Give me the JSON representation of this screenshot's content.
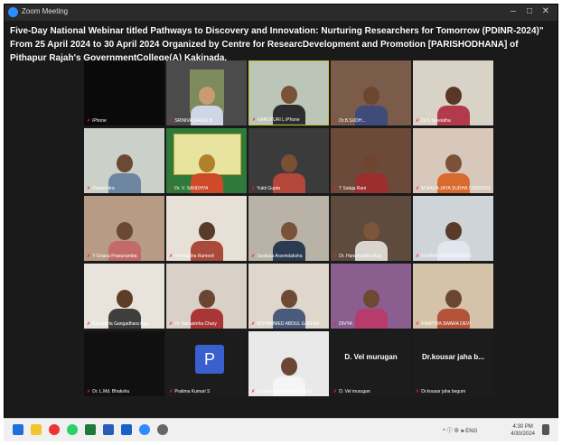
{
  "window": {
    "title": "Zoom Meeting",
    "minimize": "–",
    "maximize": "□",
    "close": "✕"
  },
  "banner": "Five-Day National Webinar titled Pathways to Discovery and Innovation: Nurturing Researchers for Tomorrow (PDINR-2024)\" From 25 April 2024 to 30 April 2024 Organized by Centre for ResearcDevelopment and Promotion [PARISHODHANA] of Pithapur Rajah's GovernmentCollege(A) Kakinada.",
  "participants": [
    {
      "name": "iPhone"
    },
    {
      "name": "SRINIVASARAO B"
    },
    {
      "name": "KARUTURI L iPhone"
    },
    {
      "name": "Dr.B.SUDH..."
    },
    {
      "name": "Dr.K.Sreelatha"
    },
    {
      "name": "Raveendra"
    },
    {
      "name": "Dr. V. SANDHYA"
    },
    {
      "name": "Yukti Gupta"
    },
    {
      "name": "T Salaja Rani"
    },
    {
      "name": "M NAGA JAYA SUDHA 12082002004"
    },
    {
      "name": "Y Gnana Prasunamba"
    },
    {
      "name": "Hemalatha Ramesh"
    },
    {
      "name": "Sasikala Aravindaksha"
    },
    {
      "name": "Dr. Hanumantha Rao"
    },
    {
      "name": "NUNNA SRINIVASARAO"
    },
    {
      "name": "Kancharla Gangadhara Rao"
    },
    {
      "name": "Dr. Narasimha Chary"
    },
    {
      "name": "MOHAMMED ABDUL GAFFAR"
    },
    {
      "name": "DIVYA"
    },
    {
      "name": "RAMITHA SWARA DEVI"
    },
    {
      "name": "Dr. L.Md. Bhakshu"
    },
    {
      "name": "Pratima Kumari S"
    },
    {
      "name": "Dr.Sivaramakrishna Prasad"
    },
    {
      "name": "D. Vel murugan",
      "display": "D. Vel murugan"
    },
    {
      "name": "Dr.kousar jaha begum",
      "display": "Dr.kousar jaha b..."
    }
  ],
  "avatar_letter": "P",
  "taskbar": {
    "tray": "^ ⓘ ⊕ 🕪 ENG",
    "time": "4:30 PM",
    "date": "4/30/2024"
  }
}
